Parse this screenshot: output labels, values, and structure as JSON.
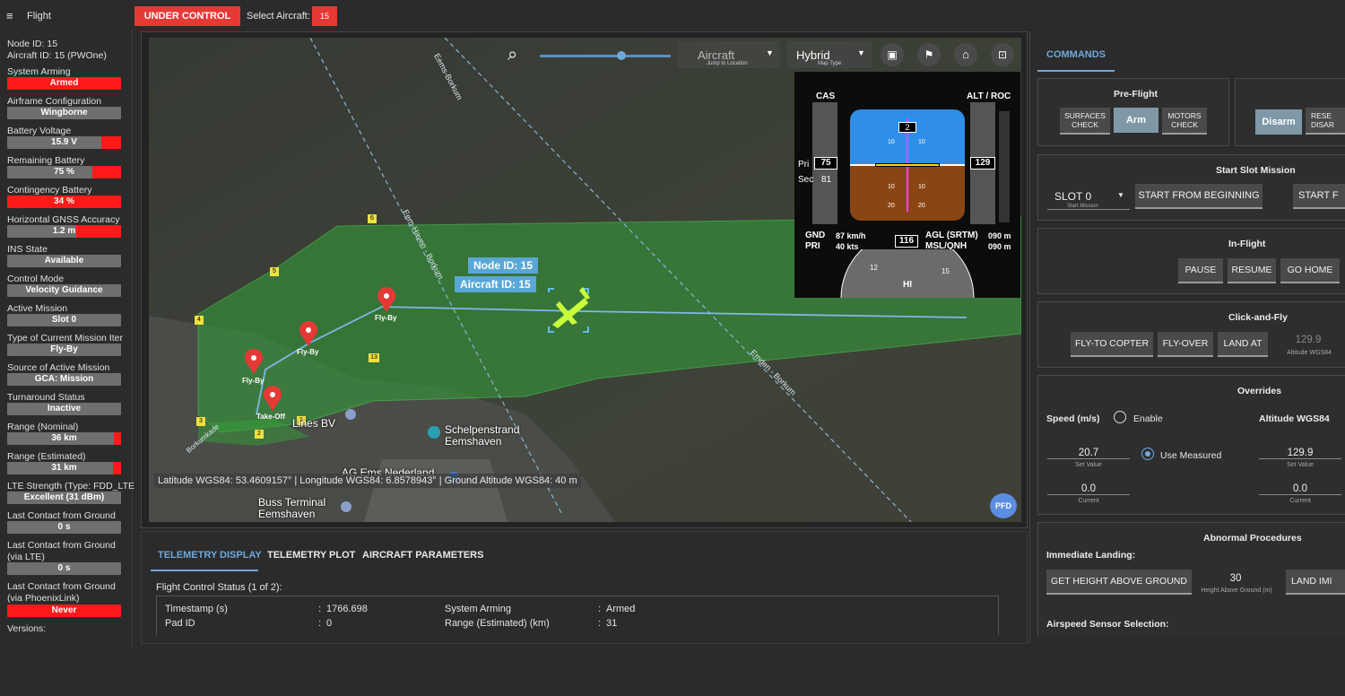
{
  "topbar": {
    "menu_icon": "hamburger-icon",
    "title": "Flight",
    "under_control": "UNDER CONTROL",
    "select_aircraft_label": "Select Aircraft:",
    "aircraft_value": "15"
  },
  "left": {
    "node_id": "Node ID: 15",
    "aircraft_id": "Aircraft ID: 15 (PWOne)",
    "system_arming_label": "System Arming",
    "system_arming_value": "Armed",
    "airframe_label": "Airframe Configuration",
    "airframe_value": "Wingborne",
    "battery_voltage_label": "Battery Voltage",
    "battery_voltage_value": "15.9 V",
    "battery_voltage_fraction": 0.82,
    "remaining_battery_label": "Remaining Battery",
    "remaining_battery_value": "75 %",
    "remaining_battery_fraction": 0.75,
    "contingency_label": "Contingency Battery",
    "contingency_value": "34 %",
    "gnss_label": "Horizontal GNSS Accuracy",
    "gnss_value": "1.2 m",
    "gnss_fraction": 0.6,
    "ins_label": "INS State",
    "ins_value": "Available",
    "control_mode_label": "Control Mode",
    "control_mode_value": "Velocity Guidance",
    "active_mission_label": "Active Mission",
    "active_mission_value": "Slot 0",
    "mission_item_label": "Type of Current Mission Iter",
    "mission_item_value": "Fly-By",
    "source_label": "Source of Active Mission",
    "source_value": "GCA: Mission",
    "turnaround_label": "Turnaround Status",
    "turnaround_value": "Inactive",
    "range_nominal_label": "Range (Nominal)",
    "range_nominal_value": "36 km",
    "range_nominal_fraction": 0.94,
    "range_est_label": "Range (Estimated)",
    "range_est_value": "31 km",
    "range_est_fraction": 0.93,
    "lte_label": "LTE Strength (Type: FDD_LTE",
    "lte_value": "Excellent (31 dBm)",
    "last_ground_label": "Last Contact from Ground",
    "last_ground_value": "0 s",
    "last_lte_label1": "Last Contact from Ground",
    "last_lte_label2": "(via LTE)",
    "last_lte_value": "0 s",
    "last_phoenix_label1": "Last Contact from Ground",
    "last_phoenix_label2": "(via PhoenixLink)",
    "last_phoenix_value": "Never",
    "versions_label": "Versions:"
  },
  "map": {
    "aircraft_dropdown": "Aircraft",
    "aircraft_dropdown_caption": "Jump to Location",
    "maptype_dropdown": "Hybrid",
    "maptype_caption": "Map Type",
    "zoom_fraction": 0.62,
    "node_label": "Node ID: 15",
    "aircraft_label": "Aircraft ID: 15",
    "waypoints": [
      "Fly-By",
      "Fly-By",
      "Fly-By",
      "Take-Off"
    ],
    "numbers": [
      "1",
      "2",
      "3",
      "4",
      "5",
      "6",
      "13"
    ],
    "road_labels": [
      "Eems-Borkum",
      "Eem-Haven - Borkum",
      "Emden - Borkum",
      "Borkumkade"
    ],
    "place1": "Schelpenstrand",
    "place1b": "Eemshaven",
    "place2": "AG Ems Nederland",
    "place3": "Buss Terminal",
    "place3b": "Eemshaven",
    "place4": "Lines BV",
    "status": "Latitude WGS84: 53.4609157° | Longitude WGS84: 6.8578943° | Ground Altitude WGS84: 40 m",
    "pfd_button": "PFD"
  },
  "pfd": {
    "cas": "CAS",
    "alt_roc": "ALT / ROC",
    "pri": "Pri",
    "sec": "Sec",
    "cas_value": "75",
    "sec_value": "81",
    "alt_value": "129",
    "heading_top": "2",
    "pitch_labels": [
      "10",
      "10",
      "10",
      "10",
      "20",
      "20",
      "20",
      "20"
    ],
    "gnd": "GND",
    "pri2": "PRI",
    "gnd_value": "87 km/h",
    "pri_value": "40 kts",
    "agl": "AGL (SRTM)",
    "msl": "MSL/QNH",
    "agl_value": "090 m",
    "msl_value": "090 m",
    "heading_value": "116",
    "hdg_hi": "HI",
    "hdg_12": "12",
    "hdg_15": "15"
  },
  "telemetry": {
    "tabs": [
      "TELEMETRY DISPLAY",
      "TELEMETRY PLOT",
      "AIRCRAFT PARAMETERS"
    ],
    "section": "Flight Control Status (1 of 2):",
    "rows": [
      {
        "k": "Timestamp (s)",
        "v": "1766.698",
        "k2": "System Arming",
        "v2": "Armed"
      },
      {
        "k": "Pad ID",
        "v": "0",
        "k2": "Range (Estimated) (km)",
        "v2": "31"
      }
    ]
  },
  "commands": {
    "tab": "COMMANDS",
    "preflight_title": "Pre-Flight",
    "surfaces_check": [
      "SURFACES",
      "CHECK"
    ],
    "arm": "Arm",
    "motors_check": [
      "MOTORS",
      "CHECK"
    ],
    "disarm": "Disarm",
    "reset": [
      "RESE",
      "DISAR"
    ],
    "slot_title": "Start Slot Mission",
    "slot_value": "SLOT 0",
    "slot_caption": "Start Mission",
    "start_beginning": "START FROM BEGINNING",
    "start_f": "START F",
    "inflight_title": "In-Flight",
    "pause": "PAUSE",
    "resume": "RESUME",
    "go_home": "GO HOME",
    "clickfly_title": "Click-and-Fly",
    "fly_to_copter": "FLY-TO COPTER",
    "fly_over": "FLY-OVER",
    "land_at": "LAND AT",
    "altitude_value": "129.9",
    "altitude_caption": "Altitude WGS84",
    "overrides_title": "Overrides",
    "speed_label": "Speed (m/s)",
    "enable_label": "Enable",
    "altitude_label": "Altitude WGS84",
    "speed_set": "20.7",
    "set_caption": "Set Value",
    "use_measured": "Use Measured",
    "alt_set": "129.9",
    "speed_current": "0.0",
    "current_caption": "Current",
    "alt_current": "0.0",
    "abnormal_title": "Abnormal Procedures",
    "immediate_landing": "Immediate Landing:",
    "get_height": "GET HEIGHT ABOVE GROUND",
    "height_value": "30",
    "height_caption": "Height Above Ground (m)",
    "land_imm": "LAND IMI",
    "airspeed_sel": "Airspeed Sensor Selection:"
  },
  "colors": {
    "red": "#ff1a1a",
    "accent_blue": "#6fa8dc",
    "green_zone": "#3a9a3a",
    "aircraft": "#c8ff3a"
  }
}
